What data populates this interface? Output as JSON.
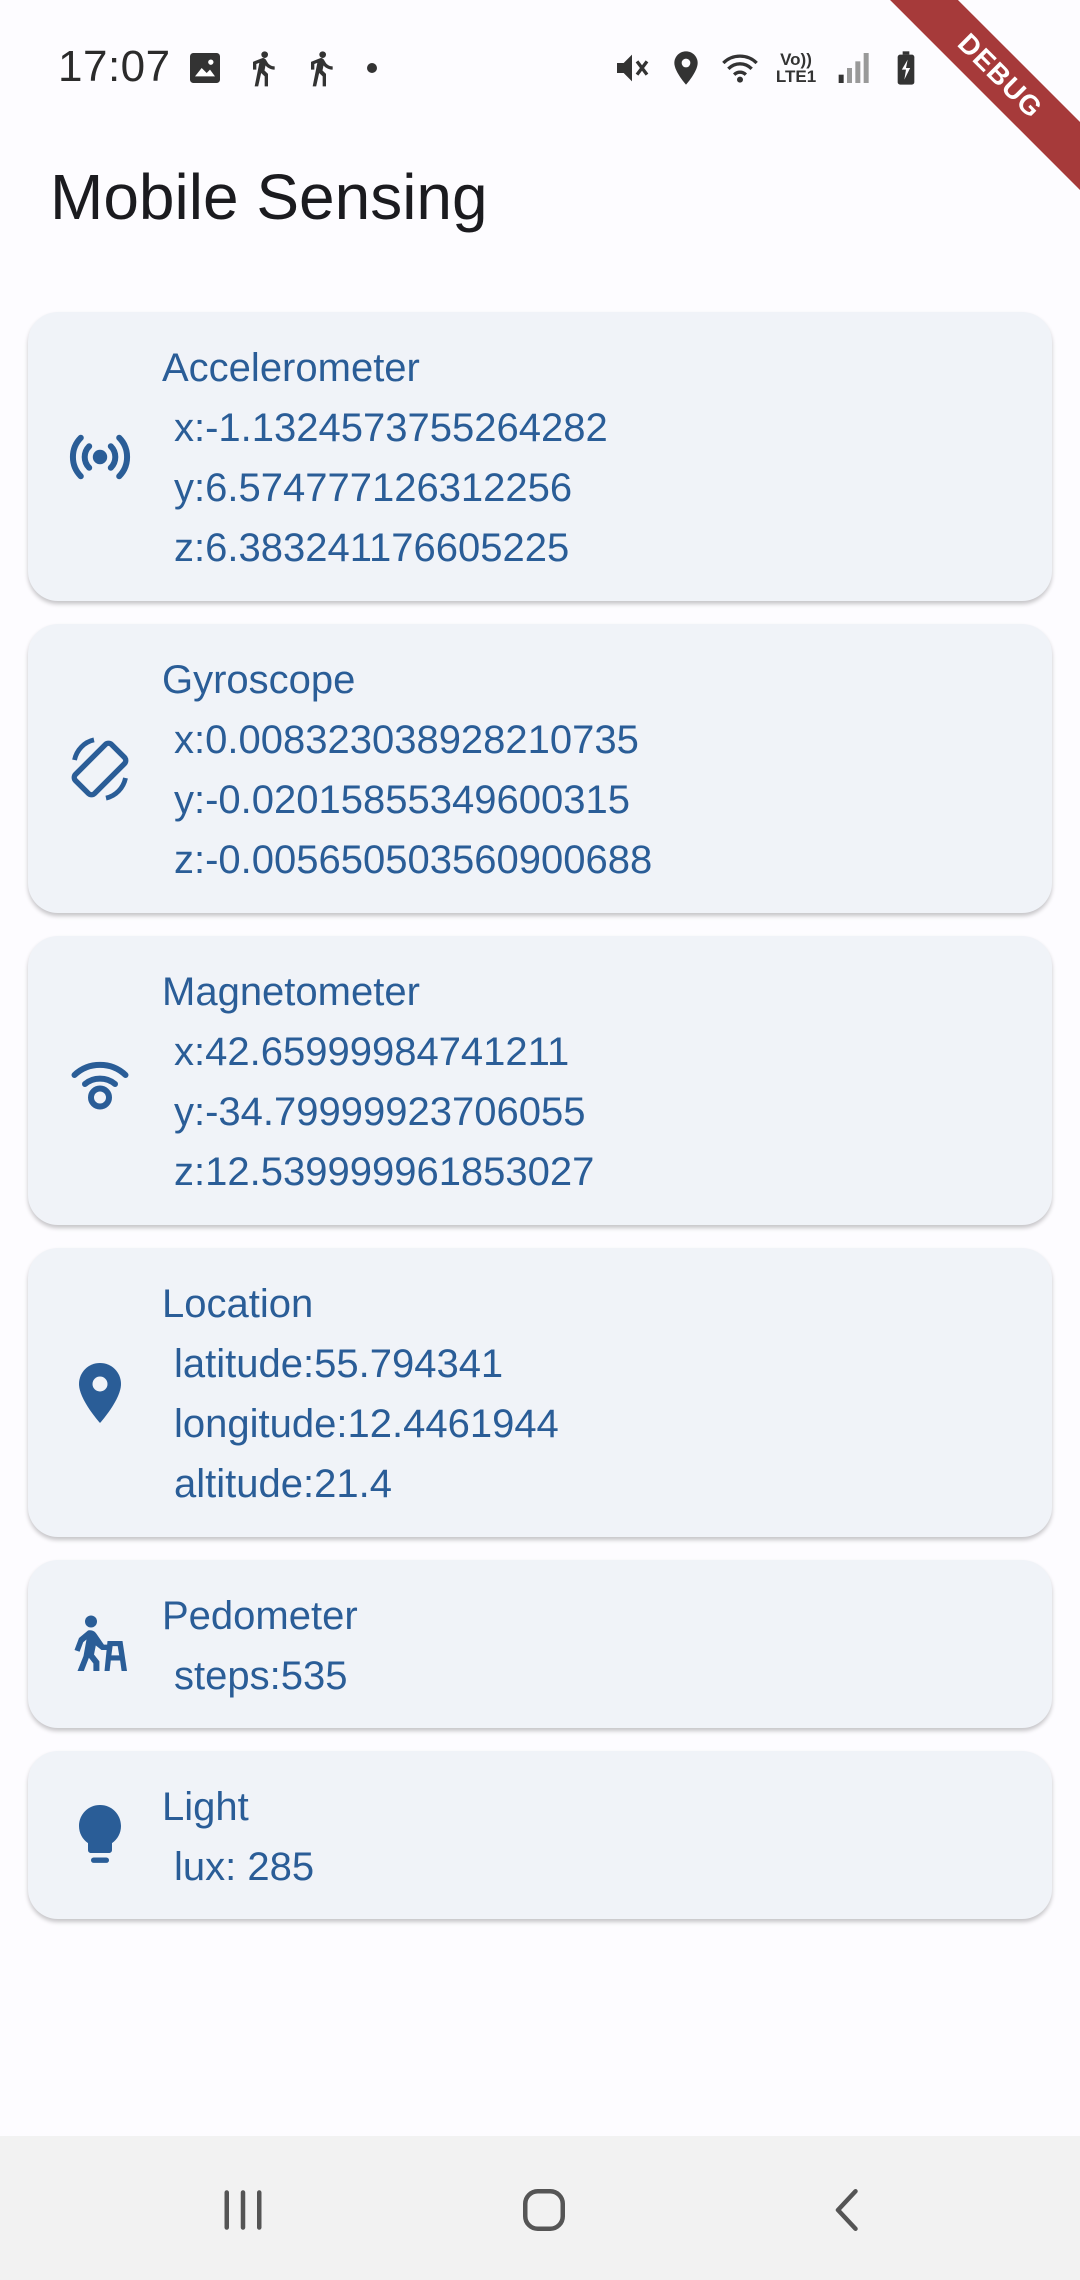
{
  "status_bar": {
    "time": "17:07",
    "left_icons": [
      "image-icon",
      "walking-icon",
      "walking-icon",
      "notification-dot"
    ],
    "right_icons": [
      "mute-icon",
      "location-icon",
      "wifi-icon",
      "volte-icon",
      "signal-icon",
      "battery-charging-icon"
    ],
    "volte_top": "Vo))",
    "volte_bottom": "LTE1"
  },
  "debug_banner": "DEBUG",
  "app_bar": {
    "title": "Mobile Sensing"
  },
  "cards": [
    {
      "icon": "sensors-icon",
      "title": "Accelerometer",
      "lines": [
        "x:-1.1324573755264282",
        "y:6.574777126312256",
        "z:6.383241176605225"
      ]
    },
    {
      "icon": "screen-rotation-icon",
      "title": "Gyroscope",
      "lines": [
        "x:0.008323038928210735",
        "y:-0.02015855349600315",
        "z:-0.005650503560900688"
      ]
    },
    {
      "icon": "magnet-wifi-icon",
      "title": "Magnetometer",
      "lines": [
        "x:42.65999984741211",
        "y:-34.79999923706055",
        "z:12.539999961853027"
      ]
    },
    {
      "icon": "location-pin-icon",
      "title": "Location",
      "lines": [
        "latitude:55.794341",
        "longitude:12.4461944",
        "altitude:21.4"
      ]
    },
    {
      "icon": "walker-icon",
      "title": "Pedometer",
      "lines": [
        "steps:535"
      ]
    },
    {
      "icon": "lightbulb-icon",
      "title": "Light",
      "lines": [
        "lux: 285"
      ]
    }
  ],
  "nav_bar": {
    "buttons": [
      "recent-apps-icon",
      "home-icon",
      "back-icon"
    ]
  },
  "colors": {
    "accent": "#2a5d97",
    "card_background": "#f0f3f8",
    "page_background": "#fdfcff",
    "debug_banner": "#a63a3a",
    "nav_background": "#f2f2f2"
  }
}
